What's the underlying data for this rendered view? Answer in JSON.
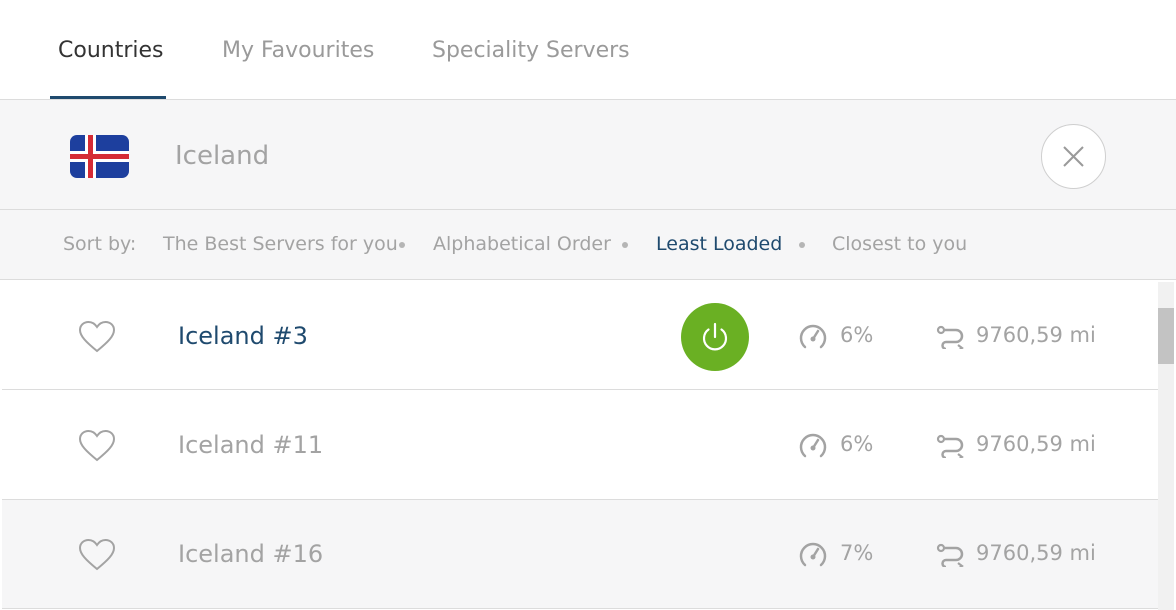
{
  "tabs": [
    {
      "label": "Countries",
      "active": true
    },
    {
      "label": "My Favourites",
      "active": false
    },
    {
      "label": "Speciality Servers",
      "active": false
    }
  ],
  "country": {
    "name": "Iceland",
    "flag_icon": "iceland-flag-icon",
    "close_icon": "close-icon"
  },
  "sort": {
    "label": "Sort by:",
    "options": [
      {
        "label": "The Best Servers for you",
        "active": false
      },
      {
        "label": "Alphabetical Order",
        "active": false
      },
      {
        "label": "Least Loaded",
        "active": true
      },
      {
        "label": "Closest to you",
        "active": false
      }
    ]
  },
  "servers": [
    {
      "name": "Iceland #3",
      "load": "6%",
      "distance": "9760,59 mi",
      "connected": true
    },
    {
      "name": "Iceland #11",
      "load": "6%",
      "distance": "9760,59 mi",
      "connected": false
    },
    {
      "name": "Iceland #16",
      "load": "7%",
      "distance": "9760,59 mi",
      "connected": false
    }
  ],
  "colors": {
    "accent": "#1f4a6e",
    "connect_green": "#6ab023",
    "muted_text": "#a3a3a3",
    "panel_bg": "#f6f6f7"
  }
}
